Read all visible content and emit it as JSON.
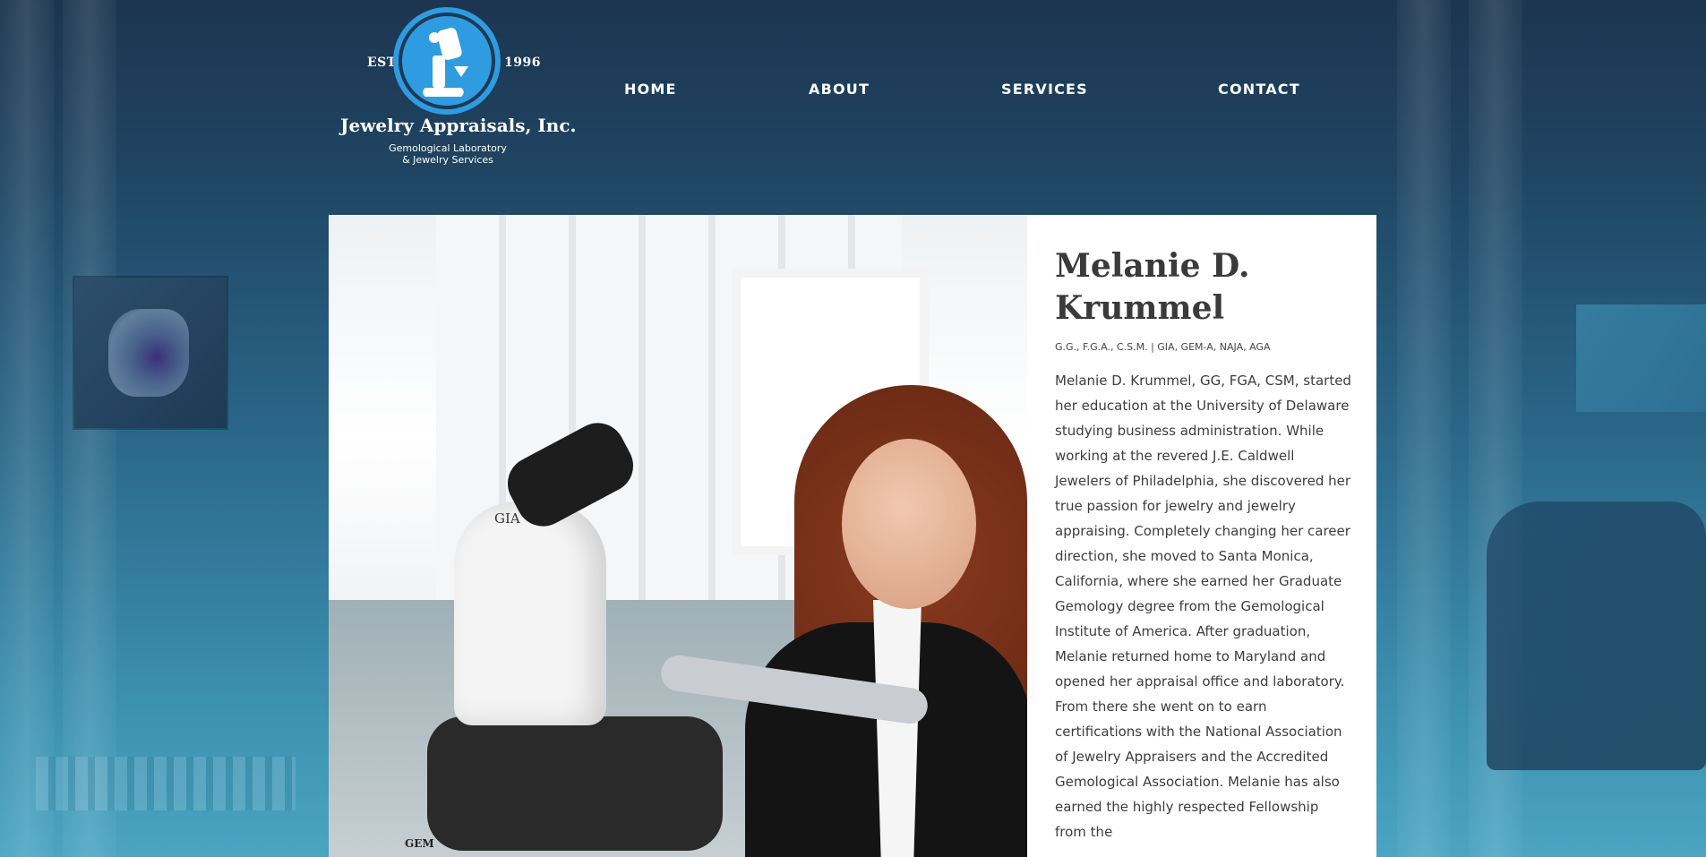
{
  "logo": {
    "est": "EST.",
    "year": "1996",
    "name": "Jewelry Appraisals, Inc.",
    "tagline_line1": "Gemological Laboratory",
    "tagline_line2": "& Jewelry Services",
    "badge_color": "#2f9be0"
  },
  "nav": {
    "items": [
      {
        "label": "HOME"
      },
      {
        "label": "ABOUT"
      },
      {
        "label": "SERVICES"
      },
      {
        "label": "CONTACT"
      }
    ]
  },
  "photo": {
    "microscope_label": "GIA",
    "base_label": "GEM"
  },
  "profile": {
    "name": "Melanie D. Krummel",
    "credentials": "G.G., F.G.A., C.S.M. | GIA, GEM-A, NAJA, AGA",
    "bio": "Melanie D. Krummel, GG, FGA, CSM, started her education at the University of Delaware studying business administration. While working at the revered J.E. Caldwell Jewelers of Philadelphia, she discovered her true passion for jewelry and jewelry appraising. Completely changing her career direction, she moved to Santa Monica, California, where she earned her Graduate Gemology degree from the Gemological Institute of America. After graduation, Melanie returned home to Maryland and opened her appraisal office and laboratory. From there she went on to earn certifications with the National Association of Jewelry Appraisers and the Accredited Gemological Association. Melanie has also earned the highly respected Fellowship from the"
  },
  "colors": {
    "accent": "#2f9be0",
    "header_bg": "#1c3550",
    "text_dark": "#3a3a3a"
  }
}
